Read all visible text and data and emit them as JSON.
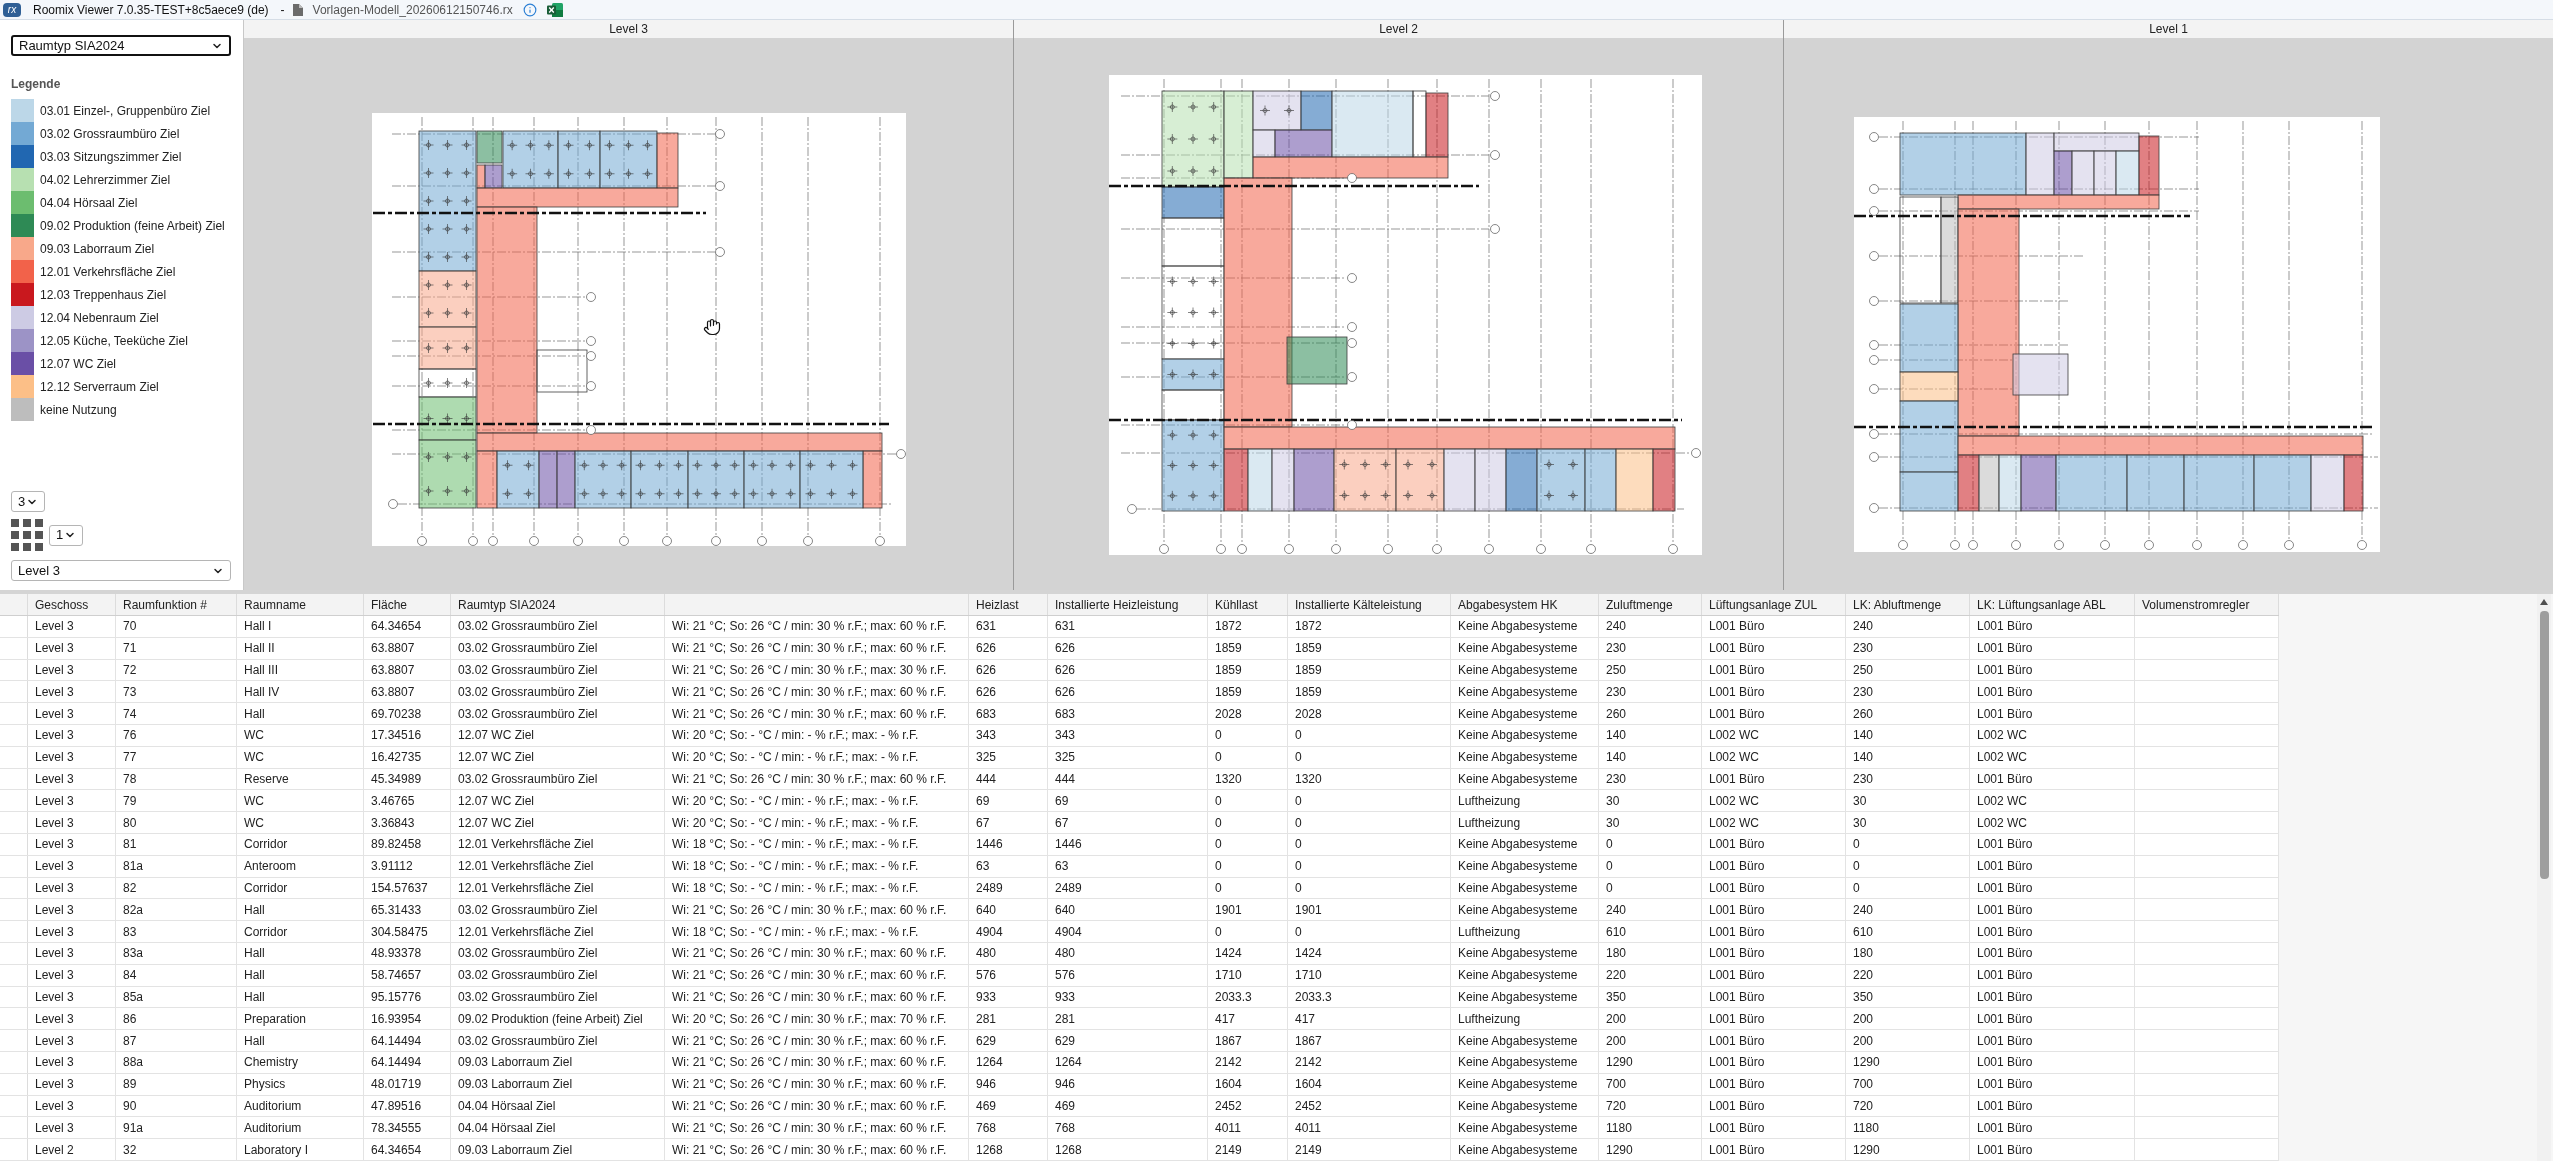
{
  "window": {
    "logo": "rx",
    "title": "Roomix Viewer 7.0.35-TEST+8c5aece9 (de)",
    "separator": "-",
    "file_name": "Vorlagen-Modell_20260612150746.rx"
  },
  "sidebar": {
    "attribute_select": {
      "value": "Raumtyp SIA2024",
      "focused": true
    },
    "legend": {
      "title": "Legende",
      "items": [
        {
          "label": "03.01 Einzel-, Gruppenbüro Ziel",
          "color": "#bcd7e8"
        },
        {
          "label": "03.02 Grossraumbüro Ziel",
          "color": "#73a9d4"
        },
        {
          "label": "03.03 Sitzungszimmer Ziel",
          "color": "#2167b1"
        },
        {
          "label": "04.02 Lehrerzimmer Ziel",
          "color": "#b7e0b1"
        },
        {
          "label": "04.04 Hörsaal Ziel",
          "color": "#6cbd6f"
        },
        {
          "label": "09.02 Produktion (feine Arbeit) Ziel",
          "color": "#2e8a55"
        },
        {
          "label": "09.03 Laborraum Ziel",
          "color": "#f8a88a"
        },
        {
          "label": "12.01 Verkehrsfläche Ziel",
          "color": "#f2624a"
        },
        {
          "label": "12.03 Treppenhaus Ziel",
          "color": "#c9181e"
        },
        {
          "label": "12.04 Nebenraum Ziel",
          "color": "#cdcbe4"
        },
        {
          "label": "12.05 Küche, Teeküche Ziel",
          "color": "#9c93c6"
        },
        {
          "label": "12.07 WC Ziel",
          "color": "#6a4fa6"
        },
        {
          "label": "12.12 Serverraum Ziel",
          "color": "#fcbf87"
        },
        {
          "label": "keine Nutzung",
          "color": "#bdbdbd"
        }
      ]
    },
    "pane_count_select": "3",
    "layout_select": "1",
    "level_select": "Level 3"
  },
  "viewer": {
    "panes": [
      {
        "title": "Level 3"
      },
      {
        "title": "Level 2"
      },
      {
        "title": "Level 1"
      }
    ]
  },
  "table": {
    "columns": [
      "Geschoss",
      "Raumfunktion #",
      "Raumname",
      "Fläche",
      "Raumtyp SIA2024",
      null,
      "Heizlast",
      "Installierte Heizleistung",
      "Kühllast",
      "Installierte Kälteleistung",
      "Abgabesystem HK",
      "Zuluftmenge",
      "Lüftungsanlage ZUL",
      "LK: Abluftmenge",
      "LK: Lüftungsanlage ABL",
      "Volumenstromregler"
    ],
    "rows": [
      [
        "Level 3",
        "70",
        "Hall I",
        "64.34654",
        "03.02 Grossraumbüro Ziel",
        "Wi: 21 °C; So: 26 °C / min: 30 % r.F.; max: 60 % r.F.",
        "631",
        "631",
        "1872",
        "1872",
        "Keine Abgabesysteme",
        "240",
        "L001 Büro",
        "240",
        "L001 Büro"
      ],
      [
        "Level 3",
        "71",
        "Hall II",
        "63.8807",
        "03.02 Grossraumbüro Ziel",
        "Wi: 21 °C; So: 26 °C / min: 30 % r.F.; max: 60 % r.F.",
        "626",
        "626",
        "1859",
        "1859",
        "Keine Abgabesysteme",
        "230",
        "L001 Büro",
        "230",
        "L001 Büro"
      ],
      [
        "Level 3",
        "72",
        "Hall III",
        "63.8807",
        "03.02 Grossraumbüro Ziel",
        "Wi: 21 °C; So: 26 °C / min: 30 % r.F.; max: 30 % r.F.",
        "626",
        "626",
        "1859",
        "1859",
        "Keine Abgabesysteme",
        "250",
        "L001 Büro",
        "250",
        "L001 Büro"
      ],
      [
        "Level 3",
        "73",
        "Hall IV",
        "63.8807",
        "03.02 Grossraumbüro Ziel",
        "Wi: 21 °C; So: 26 °C / min: 30 % r.F.; max: 60 % r.F.",
        "626",
        "626",
        "1859",
        "1859",
        "Keine Abgabesysteme",
        "230",
        "L001 Büro",
        "230",
        "L001 Büro"
      ],
      [
        "Level 3",
        "74",
        "Hall",
        "69.70238",
        "03.02 Grossraumbüro Ziel",
        "Wi: 21 °C; So: 26 °C / min: 30 % r.F.; max: 60 % r.F.",
        "683",
        "683",
        "2028",
        "2028",
        "Keine Abgabesysteme",
        "260",
        "L001 Büro",
        "260",
        "L001 Büro"
      ],
      [
        "Level 3",
        "76",
        "WC",
        "17.34516",
        "12.07 WC Ziel",
        "Wi: 20 °C; So: - °C / min: - % r.F.; max: - % r.F.",
        "343",
        "343",
        "0",
        "0",
        "Keine Abgabesysteme",
        "140",
        "L002 WC",
        "140",
        "L002 WC"
      ],
      [
        "Level 3",
        "77",
        "WC",
        "16.42735",
        "12.07 WC Ziel",
        "Wi: 20 °C; So: - °C / min: - % r.F.; max: - % r.F.",
        "325",
        "325",
        "0",
        "0",
        "Keine Abgabesysteme",
        "140",
        "L002 WC",
        "140",
        "L002 WC"
      ],
      [
        "Level 3",
        "78",
        "Reserve",
        "45.34989",
        "03.02 Grossraumbüro Ziel",
        "Wi: 21 °C; So: 26 °C / min: 30 % r.F.; max: 60 % r.F.",
        "444",
        "444",
        "1320",
        "1320",
        "Keine Abgabesysteme",
        "230",
        "L001 Büro",
        "230",
        "L001 Büro"
      ],
      [
        "Level 3",
        "79",
        "WC",
        "3.46765",
        "12.07 WC Ziel",
        "Wi: 20 °C; So: - °C / min: - % r.F.; max: - % r.F.",
        "69",
        "69",
        "0",
        "0",
        "Luftheizung",
        "30",
        "L002 WC",
        "30",
        "L002 WC"
      ],
      [
        "Level 3",
        "80",
        "WC",
        "3.36843",
        "12.07 WC Ziel",
        "Wi: 20 °C; So: - °C / min: - % r.F.; max: - % r.F.",
        "67",
        "67",
        "0",
        "0",
        "Luftheizung",
        "30",
        "L002 WC",
        "30",
        "L002 WC"
      ],
      [
        "Level 3",
        "81",
        "Corridor",
        "89.82458",
        "12.01 Verkehrsfläche Ziel",
        "Wi: 18 °C; So: - °C / min: - % r.F.; max: - % r.F.",
        "1446",
        "1446",
        "0",
        "0",
        "Keine Abgabesysteme",
        "0",
        "L001 Büro",
        "0",
        "L001 Büro"
      ],
      [
        "Level 3",
        "81a",
        "Anteroom",
        "3.91112",
        "12.01 Verkehrsfläche Ziel",
        "Wi: 18 °C; So: - °C / min: - % r.F.; max: - % r.F.",
        "63",
        "63",
        "0",
        "0",
        "Keine Abgabesysteme",
        "0",
        "L001 Büro",
        "0",
        "L001 Büro"
      ],
      [
        "Level 3",
        "82",
        "Corridor",
        "154.57637",
        "12.01 Verkehrsfläche Ziel",
        "Wi: 18 °C; So: - °C / min: - % r.F.; max: - % r.F.",
        "2489",
        "2489",
        "0",
        "0",
        "Keine Abgabesysteme",
        "0",
        "L001 Büro",
        "0",
        "L001 Büro"
      ],
      [
        "Level 3",
        "82a",
        "Hall",
        "65.31433",
        "03.02 Grossraumbüro Ziel",
        "Wi: 21 °C; So: 26 °C / min: 30 % r.F.; max: 60 % r.F.",
        "640",
        "640",
        "1901",
        "1901",
        "Keine Abgabesysteme",
        "240",
        "L001 Büro",
        "240",
        "L001 Büro"
      ],
      [
        "Level 3",
        "83",
        "Corridor",
        "304.58475",
        "12.01 Verkehrsfläche Ziel",
        "Wi: 18 °C; So: - °C / min: - % r.F.; max: - % r.F.",
        "4904",
        "4904",
        "0",
        "0",
        "Luftheizung",
        "610",
        "L001 Büro",
        "610",
        "L001 Büro"
      ],
      [
        "Level 3",
        "83a",
        "Hall",
        "48.93378",
        "03.02 Grossraumbüro Ziel",
        "Wi: 21 °C; So: 26 °C / min: 30 % r.F.; max: 60 % r.F.",
        "480",
        "480",
        "1424",
        "1424",
        "Keine Abgabesysteme",
        "180",
        "L001 Büro",
        "180",
        "L001 Büro"
      ],
      [
        "Level 3",
        "84",
        "Hall",
        "58.74657",
        "03.02 Grossraumbüro Ziel",
        "Wi: 21 °C; So: 26 °C / min: 30 % r.F.; max: 60 % r.F.",
        "576",
        "576",
        "1710",
        "1710",
        "Keine Abgabesysteme",
        "220",
        "L001 Büro",
        "220",
        "L001 Büro"
      ],
      [
        "Level 3",
        "85a",
        "Hall",
        "95.15776",
        "03.02 Grossraumbüro Ziel",
        "Wi: 21 °C; So: 26 °C / min: 30 % r.F.; max: 60 % r.F.",
        "933",
        "933",
        "2033.3",
        "2033.3",
        "Keine Abgabesysteme",
        "350",
        "L001 Büro",
        "350",
        "L001 Büro"
      ],
      [
        "Level 3",
        "86",
        "Preparation",
        "16.93954",
        "09.02 Produktion (feine Arbeit) Ziel",
        "Wi: 20 °C; So: 26 °C / min: 30 % r.F.; max: 70 % r.F.",
        "281",
        "281",
        "417",
        "417",
        "Luftheizung",
        "200",
        "L001 Büro",
        "200",
        "L001 Büro"
      ],
      [
        "Level 3",
        "87",
        "Hall",
        "64.14494",
        "03.02 Grossraumbüro Ziel",
        "Wi: 21 °C; So: 26 °C / min: 30 % r.F.; max: 60 % r.F.",
        "629",
        "629",
        "1867",
        "1867",
        "Keine Abgabesysteme",
        "200",
        "L001 Büro",
        "200",
        "L001 Büro"
      ],
      [
        "Level 3",
        "88a",
        "Chemistry",
        "64.14494",
        "09.03 Laborraum Ziel",
        "Wi: 21 °C; So: 26 °C / min: 30 % r.F.; max: 60 % r.F.",
        "1264",
        "1264",
        "2142",
        "2142",
        "Keine Abgabesysteme",
        "1290",
        "L001 Büro",
        "1290",
        "L001 Büro"
      ],
      [
        "Level 3",
        "89",
        "Physics",
        "48.01719",
        "09.03 Laborraum Ziel",
        "Wi: 21 °C; So: 26 °C / min: 30 % r.F.; max: 60 % r.F.",
        "946",
        "946",
        "1604",
        "1604",
        "Keine Abgabesysteme",
        "700",
        "L001 Büro",
        "700",
        "L001 Büro"
      ],
      [
        "Level 3",
        "90",
        "Auditorium",
        "47.89516",
        "04.04 Hörsaal Ziel",
        "Wi: 21 °C; So: 26 °C / min: 30 % r.F.; max: 60 % r.F.",
        "469",
        "469",
        "2452",
        "2452",
        "Keine Abgabesysteme",
        "720",
        "L001 Büro",
        "720",
        "L001 Büro"
      ],
      [
        "Level 3",
        "91a",
        "Auditorium",
        "78.34555",
        "04.04 Hörsaal Ziel",
        "Wi: 21 °C; So: 26 °C / min: 30 % r.F.; max: 60 % r.F.",
        "768",
        "768",
        "4011",
        "4011",
        "Keine Abgabesysteme",
        "1180",
        "L001 Büro",
        "1180",
        "L001 Büro"
      ],
      [
        "Level 2",
        "32",
        "Laboratory I",
        "64.34654",
        "09.03 Laborraum Ziel",
        "Wi: 21 °C; So: 26 °C / min: 30 % r.F.; max: 60 % r.F.",
        "1268",
        "1268",
        "2149",
        "2149",
        "Keine Abgabesysteme",
        "1290",
        "L001 Büro",
        "1290",
        "L001 Büro"
      ]
    ]
  }
}
